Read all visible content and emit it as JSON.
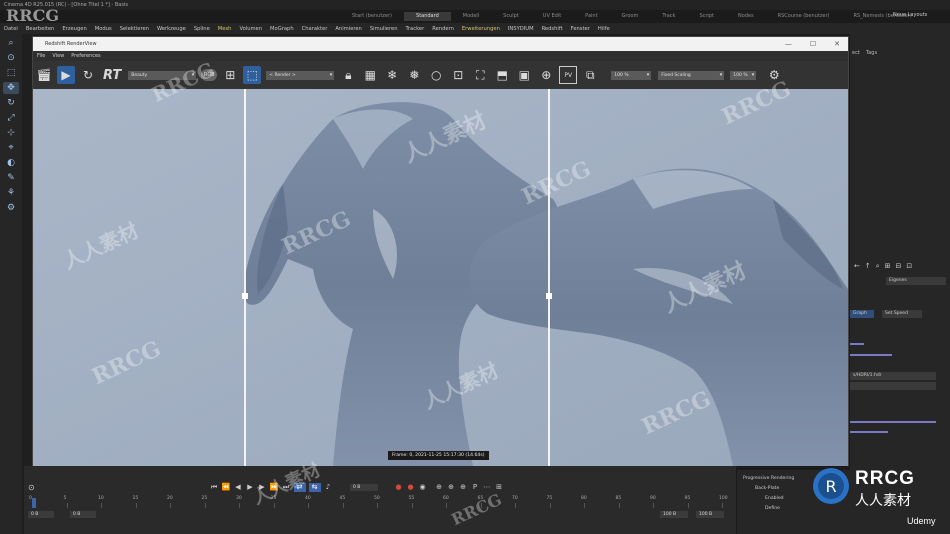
{
  "app": {
    "title": "Cinema 4D R25.015 (RC) - [Ohne Titel 1 *] - Basis",
    "layout_label": "Neue Layouts",
    "layout_tabs": [
      "Start (benutzer)",
      "Standard",
      "Modell",
      "Sculpt",
      "UV Edit",
      "Paint",
      "Groom",
      "Track",
      "Script",
      "Nodes",
      "RSCourse (benutzer)",
      "RS_Nemesis (benutzer)"
    ],
    "active_layout_index": 1
  },
  "menu": [
    "Datei",
    "Bearbeiten",
    "Erzeugen",
    "Modus",
    "Selektieren",
    "Werkzeuge",
    "Spline",
    "Mesh",
    "Volumen",
    "MoGraph",
    "Charakter",
    "Animieren",
    "Simulieren",
    "Tracker",
    "Rendern",
    "Erweiterungen",
    "INSYDIUM",
    "Redshift",
    "Fenster",
    "Hilfe"
  ],
  "menu_highlight": [
    "Mesh",
    "Erweiterungen"
  ],
  "render_view": {
    "title": "Redshift RenderView",
    "menu": [
      "File",
      "View",
      "Preferences"
    ],
    "rt_label": "RT",
    "beauty_dropdown": "Beauty",
    "rgb_label": "RGB",
    "render_dropdown": "< Render >",
    "zoom_left": "100 %",
    "scaling_dropdown": "Fixed Scaling",
    "zoom_right": "100 %",
    "pv_label": "PV",
    "frame_label": "Frame: 0,  2021-11-25  15:17:30  (14.64s)"
  },
  "timeline": {
    "ticks": [
      "0",
      "5",
      "10",
      "15",
      "20",
      "25",
      "30",
      "35",
      "40",
      "45",
      "50",
      "55",
      "60",
      "65",
      "70",
      "75",
      "80",
      "85",
      "90",
      "95",
      "100"
    ],
    "current_frame_field": "0 B",
    "start_field": "0 B",
    "start_field2": "0 B",
    "end_field": "100 B",
    "end_field2": "100 B"
  },
  "progressive": {
    "title": "Progressive Rendering",
    "item1": "Back-Plate",
    "item2": "Enabled",
    "item3": "Define"
  },
  "right_panel": {
    "tab1": "Tags",
    "dropdown1": "Eigenes",
    "row_graph": "Graph",
    "row_set": "Set Speed",
    "row_hdri": "s/HDRI/1.hdr"
  },
  "watermarks": {
    "rrcg": "RRCG",
    "cn": "人人素材",
    "brand_name": "RRCG",
    "brand_cn": "人人素材",
    "udemy": "Udemy"
  },
  "colors": {
    "accent_blue": "#2e5f9e",
    "viewport_bg": "#a3b0c2",
    "slider_purple": "#7b78c4"
  }
}
